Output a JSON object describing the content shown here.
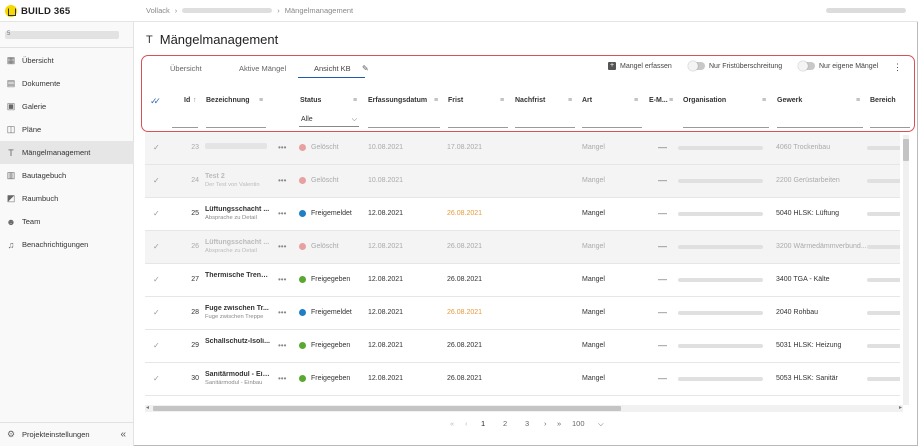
{
  "app": {
    "name": "BUILD 365"
  },
  "breadcrumb": {
    "root": "Vollack",
    "current": "Mängelmanagement"
  },
  "sidebar": {
    "project_sub": "5",
    "items": [
      {
        "label": "Übersicht",
        "icon": "dashboard-icon",
        "glyph": "▦"
      },
      {
        "label": "Dokumente",
        "icon": "document-icon",
        "glyph": "▤"
      },
      {
        "label": "Galerie",
        "icon": "gallery-icon",
        "glyph": "▣"
      },
      {
        "label": "Pläne",
        "icon": "map-icon",
        "glyph": "◫"
      },
      {
        "label": "Mängelmanagement",
        "icon": "hammer-icon",
        "glyph": "T",
        "active": true
      },
      {
        "label": "Bautagebuch",
        "icon": "book-icon",
        "glyph": "▥"
      },
      {
        "label": "Raumbuch",
        "icon": "room-icon",
        "glyph": "◩"
      },
      {
        "label": "Team",
        "icon": "team-icon",
        "glyph": "☻"
      },
      {
        "label": "Benachrichtigungen",
        "icon": "bell-icon",
        "glyph": "♫"
      }
    ],
    "settings_label": "Projekteinstellungen"
  },
  "page": {
    "title": "Mängelmanagement"
  },
  "tabs": [
    {
      "label": "Übersicht"
    },
    {
      "label": "Aktive Mängel"
    },
    {
      "label": "Ansicht KB",
      "active": true
    }
  ],
  "toolbar": {
    "add_label": "Mangel erfassen",
    "toggle1_label": "Nur Fristüberschreitung",
    "toggle2_label": "Nur eigene Mängel"
  },
  "columns": {
    "id": "Id",
    "bezeichnung": "Bezeichnung",
    "status": "Status",
    "erfassungsdatum": "Erfassungsdatum",
    "frist": "Frist",
    "nachfrist": "Nachfrist",
    "art": "Art",
    "email": "E-M...",
    "organisation": "Organisation",
    "gewerk": "Gewerk",
    "bereich": "Bereich"
  },
  "status_filter": {
    "value": "Alle"
  },
  "rows": [
    {
      "id": "23",
      "title": "",
      "sub": "",
      "status": "Gelöscht",
      "status_color": "#e8a0a0",
      "erfasst": "10.08.2021",
      "frist": "17.08.2021",
      "frist_orange": false,
      "art": "Mangel",
      "gewerk": "4060 Trockenbau",
      "deleted": true
    },
    {
      "id": "24",
      "title": "Test 2",
      "sub": "Der Test von Valentin",
      "status": "Gelöscht",
      "status_color": "#e8a0a0",
      "erfasst": "10.08.2021",
      "frist": "",
      "frist_orange": false,
      "art": "Mangel",
      "gewerk": "2200 Gerüstarbeiten",
      "deleted": true
    },
    {
      "id": "25",
      "title": "Lüftungsschacht ...",
      "sub": "Absprache zu Detail",
      "status": "Freigemeldet",
      "status_color": "#1f7fc4",
      "erfasst": "12.08.2021",
      "frist": "26.08.2021",
      "frist_orange": true,
      "art": "Mangel",
      "gewerk": "5040 HLSK: Lüftung",
      "deleted": false
    },
    {
      "id": "26",
      "title": "Lüftungsschacht ...",
      "sub": "Absprache zu Detail",
      "status": "Gelöscht",
      "status_color": "#e8a0a0",
      "erfasst": "12.08.2021",
      "frist": "26.08.2021",
      "frist_orange": false,
      "art": "Mangel",
      "gewerk": "3200 Wärmedämmverbund...",
      "deleted": true
    },
    {
      "id": "27",
      "title": "Thermische Trenn...",
      "sub": "",
      "status": "Freigegeben",
      "status_color": "#5aa832",
      "erfasst": "12.08.2021",
      "frist": "26.08.2021",
      "frist_orange": false,
      "art": "Mangel",
      "gewerk": "3400 TGA - Kälte",
      "deleted": false
    },
    {
      "id": "28",
      "title": "Fuge zwischen Tr...",
      "sub": "Fuge zwischen Treppe",
      "status": "Freigemeldet",
      "status_color": "#1f7fc4",
      "erfasst": "12.08.2021",
      "frist": "26.08.2021",
      "frist_orange": true,
      "art": "Mangel",
      "gewerk": "2040 Rohbau",
      "deleted": false
    },
    {
      "id": "29",
      "title": "Schallschutz-Isoli...",
      "sub": "",
      "status": "Freigegeben",
      "status_color": "#5aa832",
      "erfasst": "12.08.2021",
      "frist": "26.08.2021",
      "frist_orange": false,
      "art": "Mangel",
      "gewerk": "5031 HLSK: Heizung",
      "deleted": false
    },
    {
      "id": "30",
      "title": "Sanitärmodul - Ein...",
      "sub": "Sanitärmodul - Einbau",
      "status": "Freigegeben",
      "status_color": "#5aa832",
      "erfasst": "12.08.2021",
      "frist": "26.08.2021",
      "frist_orange": false,
      "art": "Mangel",
      "gewerk": "5053 HLSK: Sanitär",
      "deleted": false
    }
  ],
  "pagination": {
    "first": "«",
    "prev": "‹",
    "pages": [
      "1",
      "2",
      "3"
    ],
    "next": "›",
    "last": "»",
    "page_size": "100"
  }
}
